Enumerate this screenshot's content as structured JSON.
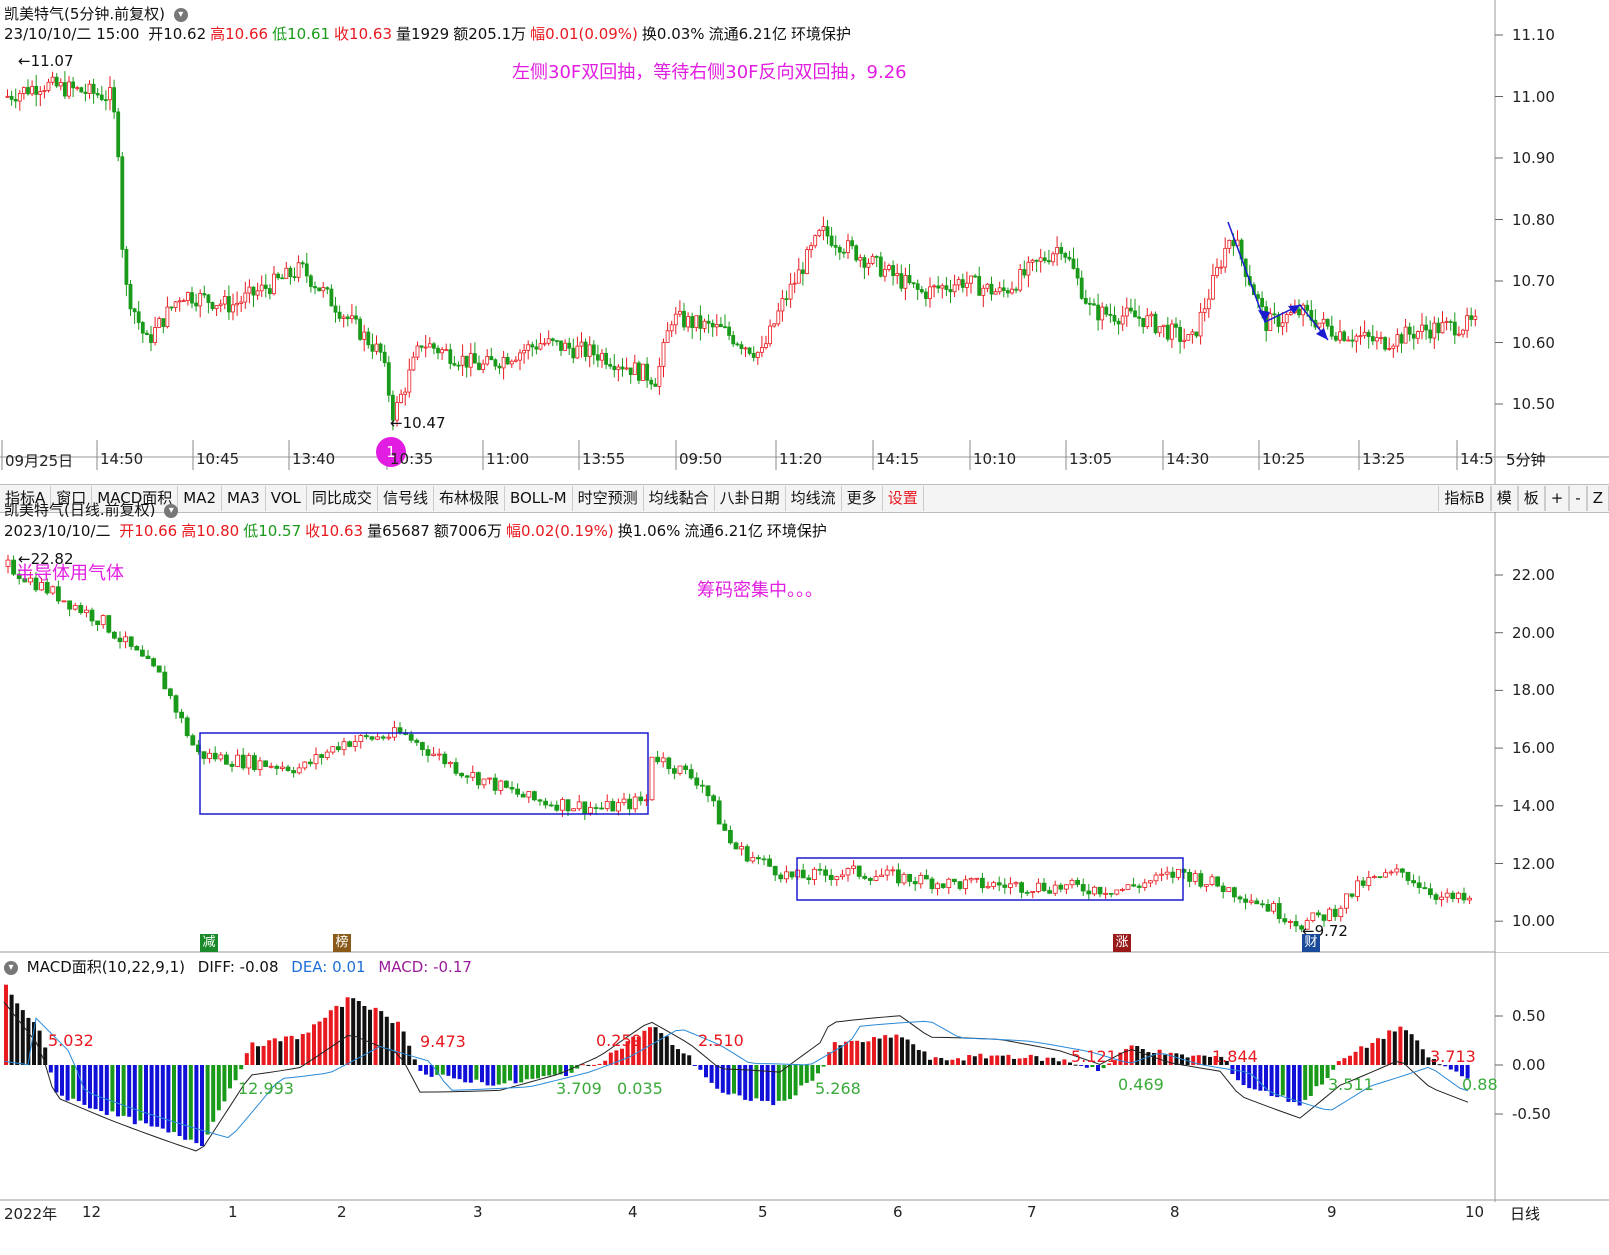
{
  "colors": {
    "up": "#e8191f",
    "down": "#1a9a1a",
    "annot": "#e11de1",
    "box": "#1a1ad0",
    "macd_blue": "#1010d8",
    "dea": "#2a8ad8",
    "diff": "#222222"
  },
  "intraday": {
    "title": "凯美特气(5分钟.前复权)",
    "info": [
      {
        "t": "23/10/10/二 15:00 ",
        "c": "blk"
      },
      {
        "t": "开10.62",
        "c": "blk"
      },
      {
        "t": "高10.66",
        "c": "red"
      },
      {
        "t": "低10.61",
        "c": "grn"
      },
      {
        "t": "收10.63",
        "c": "red"
      },
      {
        "t": "量1929",
        "c": "blk"
      },
      {
        "t": "额205.1万",
        "c": "blk"
      },
      {
        "t": "幅0.01(0.09%)",
        "c": "red"
      },
      {
        "t": "换0.03%",
        "c": "blk"
      },
      {
        "t": "流通6.21亿",
        "c": "blk"
      },
      {
        "t": "环境保护",
        "c": "blk"
      }
    ],
    "note": "左侧30F双回抽，等待右侧30F反向双回抽，9.26",
    "high_label": "11.07",
    "low_label": "10.47",
    "marker": "1",
    "yticks": [
      "11.10",
      "11.00",
      "10.90",
      "10.80",
      "10.70",
      "10.60",
      "10.50"
    ],
    "xticks": [
      "09月25日",
      "14:50",
      "10:45",
      "13:40",
      "10:35",
      "11:00",
      "13:55",
      "09:50",
      "11:20",
      "14:15",
      "10:10",
      "13:05",
      "14:30",
      "10:25",
      "13:25",
      "14:5"
    ],
    "period": "5分钟"
  },
  "toolbar": {
    "items": [
      "指标A",
      "窗口",
      "MACD面积",
      "MA2",
      "MA3",
      "VOL",
      "同比成交",
      "信号线",
      "布林极限",
      "BOLL-M",
      "时空预测",
      "均线黏合",
      "八卦日期",
      "均线流",
      "更多",
      "设置"
    ],
    "right": [
      "指标B",
      "模",
      "板",
      "+",
      "-",
      "Z"
    ]
  },
  "daily": {
    "title": "凯美特气(日线.前复权)",
    "info": [
      {
        "t": "2023/10/10/二 ",
        "c": "blk"
      },
      {
        "t": "开10.66",
        "c": "red"
      },
      {
        "t": "高10.80",
        "c": "red"
      },
      {
        "t": "低10.57",
        "c": "grn"
      },
      {
        "t": "收10.63",
        "c": "red"
      },
      {
        "t": "量65687",
        "c": "blk"
      },
      {
        "t": "额7006万",
        "c": "blk"
      },
      {
        "t": "幅0.02(0.19%)",
        "c": "red"
      },
      {
        "t": "换1.06%",
        "c": "blk"
      },
      {
        "t": "流通6.21亿",
        "c": "blk"
      },
      {
        "t": "环境保护",
        "c": "blk"
      }
    ],
    "note1": "半导体用气体",
    "note2": "筹码密集中。。。",
    "high_label": "22.82",
    "low_label": "9.72",
    "yticks": [
      "22.00",
      "20.00",
      "18.00",
      "16.00",
      "14.00",
      "12.00",
      "10.00"
    ],
    "badges": [
      {
        "t": "减",
        "bg": "#1a8a2a"
      },
      {
        "t": "榜",
        "bg": "#8a5a1a"
      },
      {
        "t": "涨",
        "bg": "#9a1a1a"
      },
      {
        "t": "财",
        "bg": "#1a4a9a"
      }
    ]
  },
  "macd": {
    "title": "MACD面积(10,22,9,1)",
    "diff": "DIFF: -0.08",
    "dea": "DEA: 0.01",
    "macd": "MACD: -0.17",
    "yticks": [
      "0.50",
      "0.00",
      "-0.50"
    ],
    "areas_red": [
      "5.032",
      "9.473",
      "0.259",
      "2.510",
      "5.121",
      "1.844",
      "3.713"
    ],
    "areas_green": [
      "12.993",
      "3.709",
      "0.035",
      "5.268",
      "0.469",
      "3.511",
      "0.88"
    ]
  },
  "xaxis": {
    "labels": [
      "2022年",
      "12",
      "1",
      "2",
      "3",
      "4",
      "5",
      "6",
      "7",
      "8",
      "9",
      "10"
    ],
    "period": "日线"
  }
}
